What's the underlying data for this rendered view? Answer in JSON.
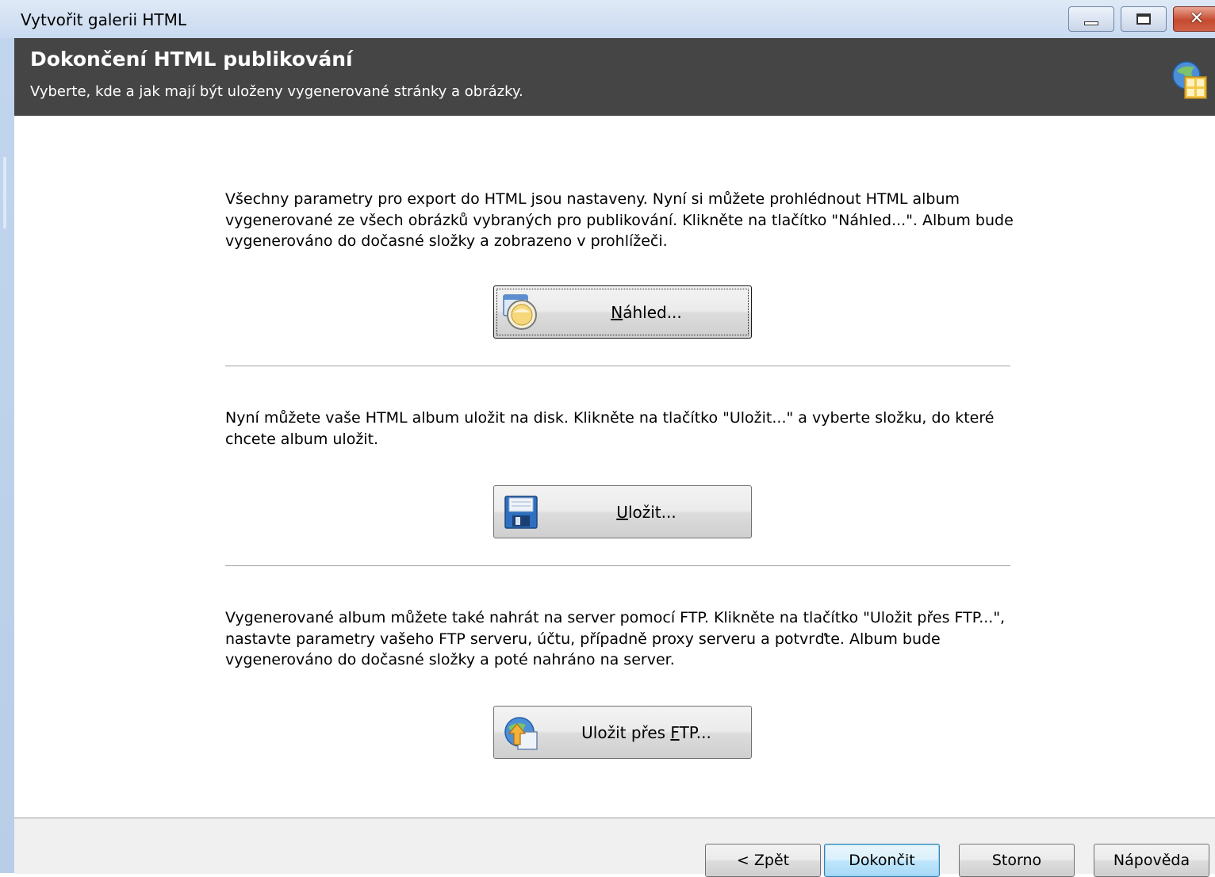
{
  "window": {
    "title": "Vytvořit galerii HTML",
    "controls": [
      "minimize",
      "maximize",
      "close"
    ],
    "close_glyph": "✕"
  },
  "header": {
    "title": "Dokončení HTML publikování",
    "subtitle": "Vyberte, kde a jak mají být uloženy vygenerované stránky a obrázky.",
    "icon": "html-gallery-icon"
  },
  "sections": [
    {
      "text": "Všechny parametry pro export do HTML jsou nastaveny. Nyní si můžete prohlédnout HTML album vygenerované ze všech obrázků vybraných pro publikování. Klikněte na tlačítko \"Náhled...\". Album bude vygenerováno do dočasné složky a zobrazeno v prohlížeči.",
      "button": {
        "accel": "N",
        "rest": "áhled...",
        "pre": "",
        "icon": "preview-icon"
      }
    },
    {
      "text": "Nyní můžete vaše HTML album uložit na disk. Klikněte na tlačítko \"Uložit...\" a vyberte složku, do které chcete album uložit.",
      "button": {
        "accel": "U",
        "rest": "ložit...",
        "pre": "",
        "icon": "floppy-disk-icon"
      }
    },
    {
      "text": "Vygenerované album můžete také nahrát na server pomocí FTP. Klikněte na tlačítko \"Uložit přes FTP...\", nastavte parametry vašeho FTP serveru, účtu, případně proxy serveru a potvrďte. Album bude vygenerováno do dočasné složky a poté nahráno na server.",
      "button": {
        "pre": "Uložit přes ",
        "accel": "F",
        "rest": "TP...",
        "icon": "ftp-upload-icon"
      }
    }
  ],
  "footer": {
    "back": "< Zpět",
    "finish": "Dokončit",
    "cancel": "Storno",
    "help": "Nápověda"
  },
  "colors": {
    "header_bg": "#454545",
    "default_button_border": "#3c7fb1"
  }
}
